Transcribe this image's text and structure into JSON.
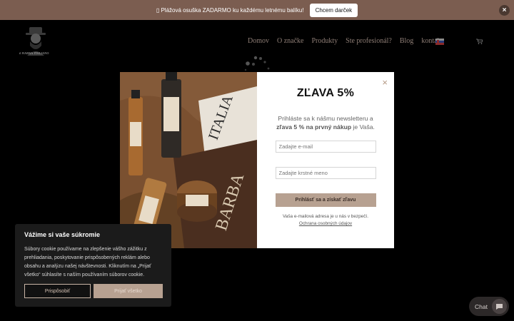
{
  "promo": {
    "text": "▯ Plážová osuška ZADARMO ku každému letnému balíku!",
    "button": "Chcem darček"
  },
  "header": {
    "logo_text": "il BARBA ITALIANO",
    "nav": [
      "Domov",
      "O značke",
      "Produkty",
      "Ste profesionál?",
      "Blog",
      "kontakt"
    ],
    "flag": "slovak-flag-icon",
    "cart": "cart-icon"
  },
  "popup": {
    "title": "ZĽAVA 5%",
    "desc_part1": "Prihláste sa k nášmu newsletteru a ",
    "desc_bold": "zľava 5 % na prvný nákup",
    "desc_part2": " je Vaša.",
    "email_placeholder": "Zadajte e-mail",
    "name_placeholder": "Zadajte krstné meno",
    "submit": "Prihlásť sa a získať zľavu",
    "privacy": "Vaša e-mailová adresa je u nás v bezpečí.",
    "privacy_link": "Ochrana osobných údajov"
  },
  "cookie": {
    "title": "Vážime si vaše súkromie",
    "text": "Súbory cookie používame na zlepšenie vášho zážitku z prehliadania, poskytovanie prispôsobených reklám alebo obsahu a analýzu našej návštevnosti. Kliknutím na „Prijať všetko“ súhlasíte s naším používaním súborov cookie.",
    "customize": "Prispôsobiť",
    "accept": "Prijať všetko"
  },
  "chat": {
    "label": "Chat"
  },
  "colors": {
    "promo_bg": "#7b5d50",
    "accent": "#b7a191",
    "nav_text": "#8f7e76"
  }
}
